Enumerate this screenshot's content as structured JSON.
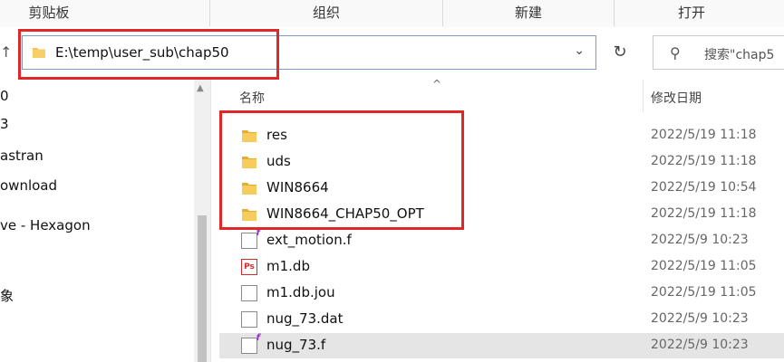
{
  "ribbon": {
    "groups": [
      "剪贴板",
      "组织",
      "新建",
      "打开"
    ]
  },
  "nav": {
    "up_icon": "up-arrow-icon",
    "address_path": "E:\\temp\\user_sub\\chap50",
    "refresh_icon": "refresh-icon",
    "search_placeholder": "搜索\"chap5"
  },
  "sidebar": {
    "items": [
      "0",
      "3",
      "astran",
      "ownload",
      "ve - Hexagon",
      "象"
    ]
  },
  "columns": {
    "name": "名称",
    "date": "修改日期"
  },
  "files": [
    {
      "name": "res",
      "date": "2022/5/19 11:18",
      "icon": "folder-icon"
    },
    {
      "name": "uds",
      "date": "2022/5/19 11:18",
      "icon": "folder-icon"
    },
    {
      "name": "WIN8664",
      "date": "2022/5/19 10:54",
      "icon": "folder-icon"
    },
    {
      "name": "WIN8664_CHAP50_OPT",
      "date": "2022/5/19 11:18",
      "icon": "folder-icon"
    },
    {
      "name": "ext_motion.f",
      "date": "2022/5/9 10:23",
      "icon": "fortran-file-icon"
    },
    {
      "name": "m1.db",
      "date": "2022/5/19 11:05",
      "icon": "ps-file-icon"
    },
    {
      "name": "m1.db.jou",
      "date": "2022/5/19 11:05",
      "icon": "blank-file-icon"
    },
    {
      "name": "nug_73.dat",
      "date": "2022/5/9 10:23",
      "icon": "blank-file-icon"
    },
    {
      "name": "nug_73.f",
      "date": "2022/5/9 10:23",
      "icon": "fortran-file-icon"
    }
  ],
  "colors": {
    "highlight": "#e02626",
    "folder": "#f2c14e",
    "selected_row": "#e5e5e5"
  }
}
